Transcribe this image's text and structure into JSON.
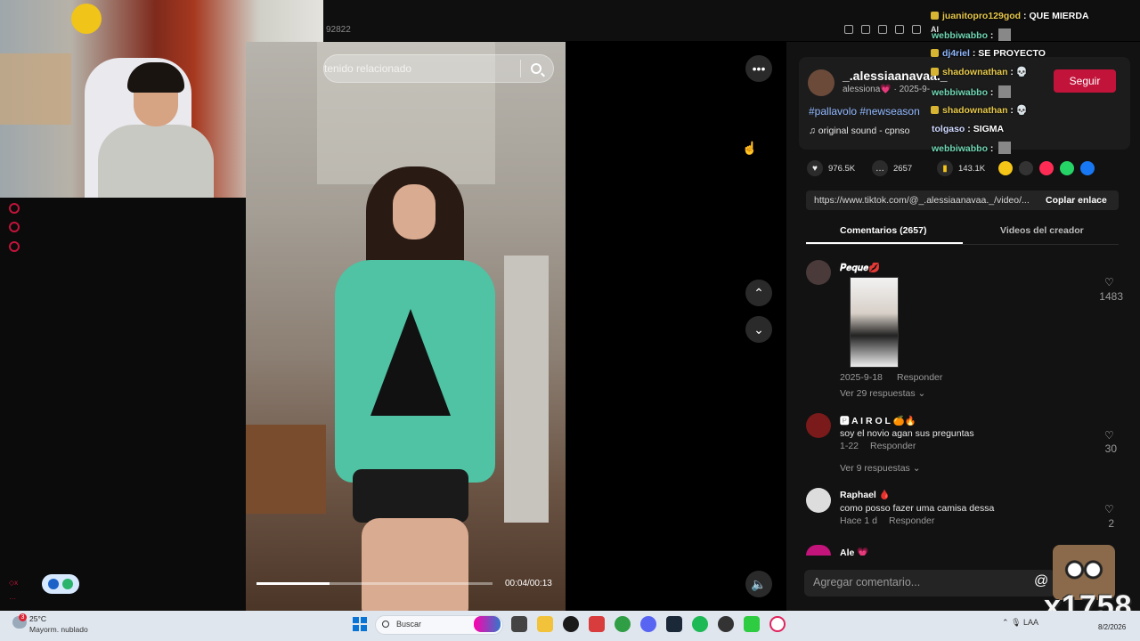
{
  "browser": {
    "url_fragment": "92822",
    "ai_label": "AI"
  },
  "search": {
    "text": "tenido relacionado"
  },
  "video": {
    "time": "00:04/00:13",
    "progress": 0.31
  },
  "post": {
    "username": "_.alessiaanavaa._",
    "subtitle": "alessiona💗 · 2025-9-",
    "follow_label": "Seguir",
    "tags": "#pallavolo #newseason",
    "sound": "original sound - cpnso",
    "stats": {
      "likes": "976.5K",
      "comments": "2657",
      "saves": "143.1K"
    },
    "link": "https://www.tiktok.com/@_.alessiaanavaa._/video/...",
    "copy_link_label": "Coplar enlace"
  },
  "tabs": {
    "comments": "Comentarios (2657)",
    "creator_videos": "Videos del creador"
  },
  "comments": [
    {
      "name": "𝑷𝒆𝒒𝒖𝒆💋",
      "text": "",
      "date": "2025-9-18",
      "reply": "Responder",
      "likes": "1483",
      "replies": "Ver 29 respuestas ⌄"
    },
    {
      "name": "🅿 A I R O L 🍊🔥",
      "text": "soy el novio agan sus preguntas",
      "date": "1-22",
      "reply": "Responder",
      "likes": "30",
      "replies": "Ver 9 respuestas ⌄"
    },
    {
      "name": "Raphael 🩸",
      "text": "como posso fazer uma camisa dessa",
      "date": "Hace 1 d",
      "reply": "Responder",
      "likes": "2",
      "replies": ""
    },
    {
      "name": "Ale 💗",
      "text": "",
      "date": "",
      "reply": "",
      "likes": "",
      "replies": ""
    }
  ],
  "comment_input": {
    "placeholder": "Agregar comentario..."
  },
  "chat": [
    {
      "user": "juanitopro129god",
      "msg": "QUE MIERDA",
      "color": "#e6c84a"
    },
    {
      "user": "webbiwabbo",
      "msg": "",
      "color": "#6fd6b4"
    },
    {
      "user": "dj4riel",
      "msg": "SE PROYECTO",
      "color": "#8fb7ff"
    },
    {
      "user": "shadownathan",
      "msg": "💀",
      "color": "#e6c84a"
    },
    {
      "user": "webbiwabbo",
      "msg": "",
      "color": "#6fd6b4"
    },
    {
      "user": "shadownathan",
      "msg": "💀",
      "color": "#e6c84a"
    },
    {
      "user": "tolgaso",
      "msg": "SIGMA",
      "color": "#cfd8ff"
    },
    {
      "user": "webbiwabbo",
      "msg": "",
      "color": "#6fd6b4"
    }
  ],
  "overlay": {
    "counter": "x1758"
  },
  "taskbar": {
    "weather_badge": "3",
    "temp": "25°C",
    "condition": "Mayorm. nublado",
    "search": "Buscar",
    "tray_lang": "LAA",
    "time": "8/2/2026"
  }
}
